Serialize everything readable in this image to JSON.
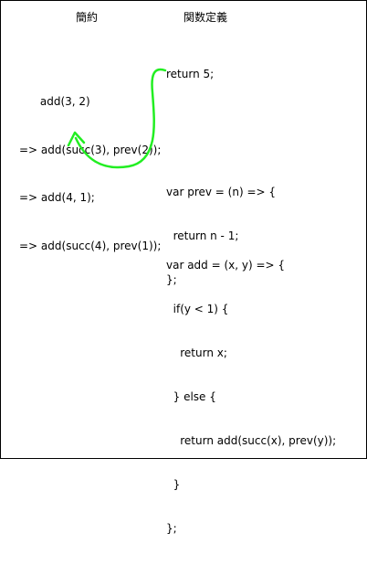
{
  "headers": {
    "reduction": "簡約",
    "definition": "関数定義"
  },
  "reduction_steps": [
    "      add(3, 2)",
    "=> add(succ(3), prev(2));",
    "=> add(4, 1);",
    "=> add(succ(4), prev(1));"
  ],
  "definitions": {
    "return_line": "return 5;",
    "prev_lines": [
      "var prev = (n) => {",
      "  return n - 1;",
      "};"
    ],
    "add_lines": [
      "var add = (x, y) => {",
      "  if(y < 1) {",
      "    return x;",
      "  } else {",
      "    return add(succ(x), prev(y));",
      "  }",
      "};"
    ]
  },
  "colors": {
    "arrow": "#22ee22",
    "text": "#000000",
    "border": "#000000"
  }
}
